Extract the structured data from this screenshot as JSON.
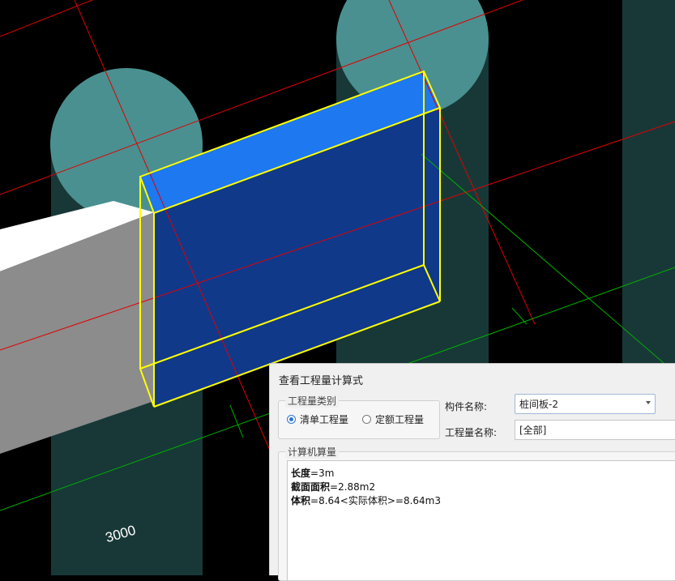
{
  "viewport": {
    "dimension_label": "3000",
    "colors": {
      "background": "#000000",
      "column_top": "#4a9090",
      "column_side": "#183838",
      "beam_top": "#ffffff",
      "beam_side": "#8c8c8c",
      "slab_face": "#10398a",
      "slab_top": "#1e78f0",
      "selection": "#ffff00",
      "axis_red": "#e00000",
      "axis_green": "#00b000"
    }
  },
  "dialog": {
    "title": "查看工程量计算式",
    "qty_type": {
      "legend": "工程量类别",
      "options": [
        {
          "label": "清单工程量",
          "selected": true
        },
        {
          "label": "定额工程量",
          "selected": false
        }
      ]
    },
    "component_name": {
      "label": "构件名称:",
      "value": "桩间板-2"
    },
    "quantity_name": {
      "label": "工程量名称:",
      "value": "[全部]"
    },
    "calc": {
      "legend": "计算机算量",
      "lines": [
        {
          "name": "长度",
          "expr": "=3m"
        },
        {
          "name": "截面面积",
          "expr": "=2.88m2"
        },
        {
          "name": "体积",
          "expr": "=8.64<实际体积>=8.64m3"
        }
      ]
    }
  }
}
